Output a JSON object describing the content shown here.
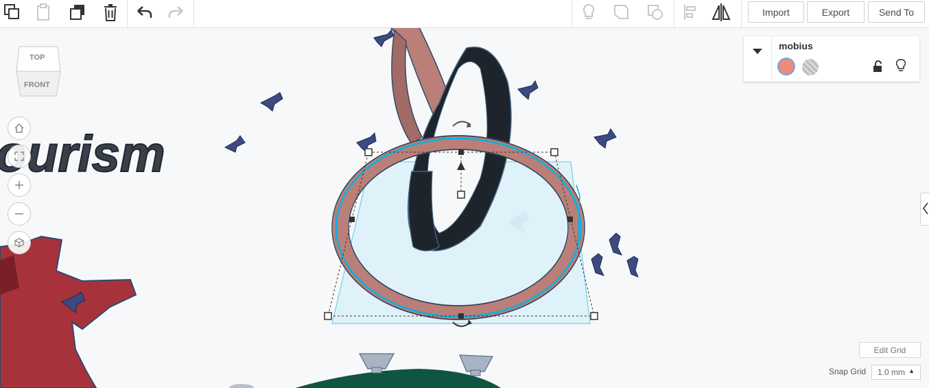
{
  "toolbar": {
    "import_label": "Import",
    "export_label": "Export",
    "send_to_label": "Send To"
  },
  "viewcube": {
    "top_label": "TOP",
    "front_label": "FRONT"
  },
  "inspector": {
    "shape_name": "mobius",
    "color_swatch": "#ef8b7d"
  },
  "workplane": {
    "text_object": "ourism",
    "edit_grid_label": "Edit Grid",
    "snap_grid_label": "Snap Grid",
    "snap_grid_value": "1.0 mm"
  },
  "colors": {
    "accent": "#00b4e6",
    "mobius_band": "#b97f78",
    "mobius_dark": "#1e242b",
    "red_shape": "#a8323b",
    "green_base": "#0f5542"
  }
}
